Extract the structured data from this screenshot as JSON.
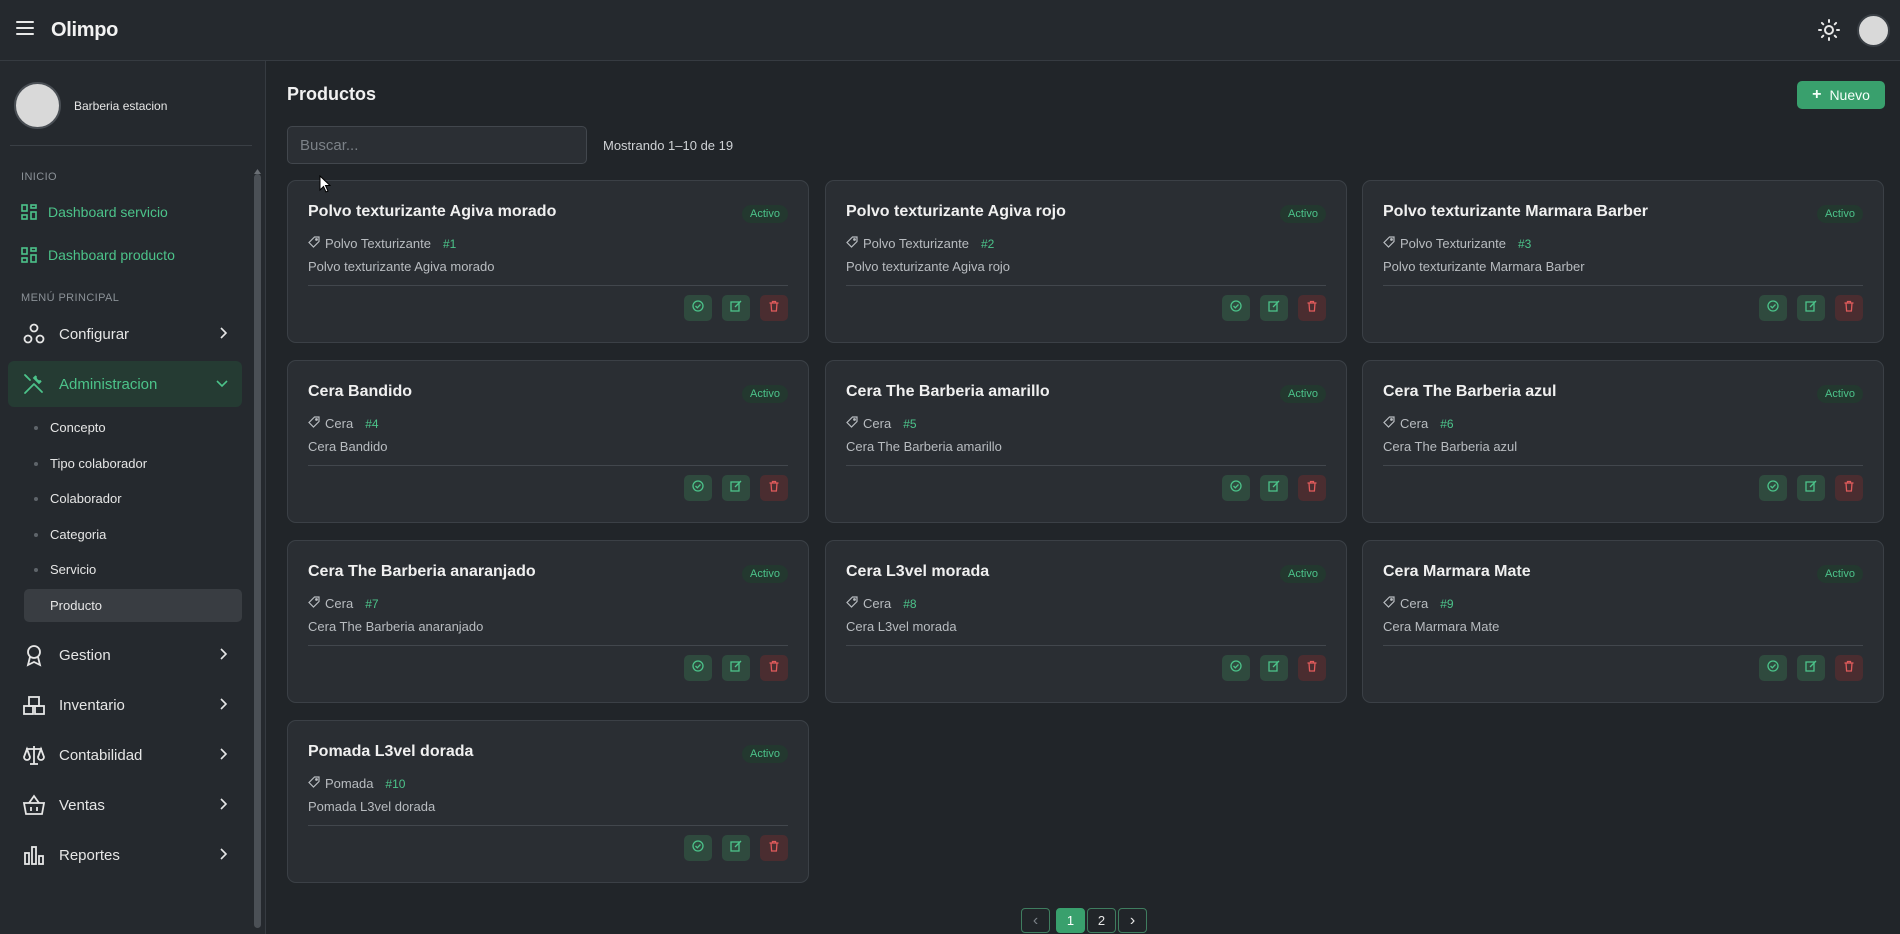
{
  "app": {
    "title": "Olimpo"
  },
  "sidebar": {
    "profile_name": "Barberia estacion",
    "section_inicio": "INICIO",
    "dashboards": [
      {
        "label": "Dashboard servicio",
        "icon": "dashboard-icon"
      },
      {
        "label": "Dashboard producto",
        "icon": "dashboard-icon"
      }
    ],
    "section_menu": "MENÚ PRINCIPAL",
    "menu": [
      {
        "label": "Configurar",
        "icon": "settings-shapes-icon"
      },
      {
        "label": "Administracion",
        "icon": "tools-icon"
      },
      {
        "label": "Gestion",
        "icon": "award-icon"
      },
      {
        "label": "Inventario",
        "icon": "boxes-icon"
      },
      {
        "label": "Contabilidad",
        "icon": "balance-scale-icon"
      },
      {
        "label": "Ventas",
        "icon": "basket-icon"
      },
      {
        "label": "Reportes",
        "icon": "bar-chart-icon"
      }
    ],
    "submenu": [
      {
        "label": "Concepto"
      },
      {
        "label": "Tipo colaborador"
      },
      {
        "label": "Colaborador"
      },
      {
        "label": "Categoria"
      },
      {
        "label": "Servicio"
      },
      {
        "label": "Producto"
      }
    ]
  },
  "main": {
    "title": "Productos",
    "new_button": "Nuevo",
    "search_placeholder": "Buscar...",
    "count_text": "Mostrando 1–10 de 19",
    "badge_label": "Activo",
    "products": [
      {
        "name": "Polvo texturizante Agiva morado",
        "category": "Polvo Texturizante",
        "num": "#1",
        "desc": "Polvo texturizante Agiva morado"
      },
      {
        "name": "Polvo texturizante Agiva rojo",
        "category": "Polvo Texturizante",
        "num": "#2",
        "desc": "Polvo texturizante Agiva rojo"
      },
      {
        "name": "Polvo texturizante Marmara Barber",
        "category": "Polvo Texturizante",
        "num": "#3",
        "desc": "Polvo texturizante Marmara Barber"
      },
      {
        "name": "Cera Bandido",
        "category": "Cera",
        "num": "#4",
        "desc": "Cera Bandido"
      },
      {
        "name": "Cera The Barberia amarillo",
        "category": "Cera",
        "num": "#5",
        "desc": "Cera The Barberia amarillo"
      },
      {
        "name": "Cera The Barberia azul",
        "category": "Cera",
        "num": "#6",
        "desc": "Cera The Barberia azul"
      },
      {
        "name": "Cera The Barberia anaranjado",
        "category": "Cera",
        "num": "#7",
        "desc": "Cera The Barberia anaranjado"
      },
      {
        "name": "Cera L3vel morada",
        "category": "Cera",
        "num": "#8",
        "desc": "Cera L3vel morada"
      },
      {
        "name": "Cera Marmara Mate",
        "category": "Cera",
        "num": "#9",
        "desc": "Cera Marmara Mate"
      },
      {
        "name": "Pomada L3vel dorada",
        "category": "Pomada",
        "num": "#10",
        "desc": "Pomada L3vel dorada"
      }
    ],
    "pagination": {
      "prev": "‹",
      "pages": [
        "1",
        "2"
      ],
      "next": "›",
      "current": "1"
    }
  },
  "colors": {
    "accent": "#4cc38a",
    "accent_button": "#39a06d",
    "danger": "#e05b5b",
    "background": "#212529"
  }
}
